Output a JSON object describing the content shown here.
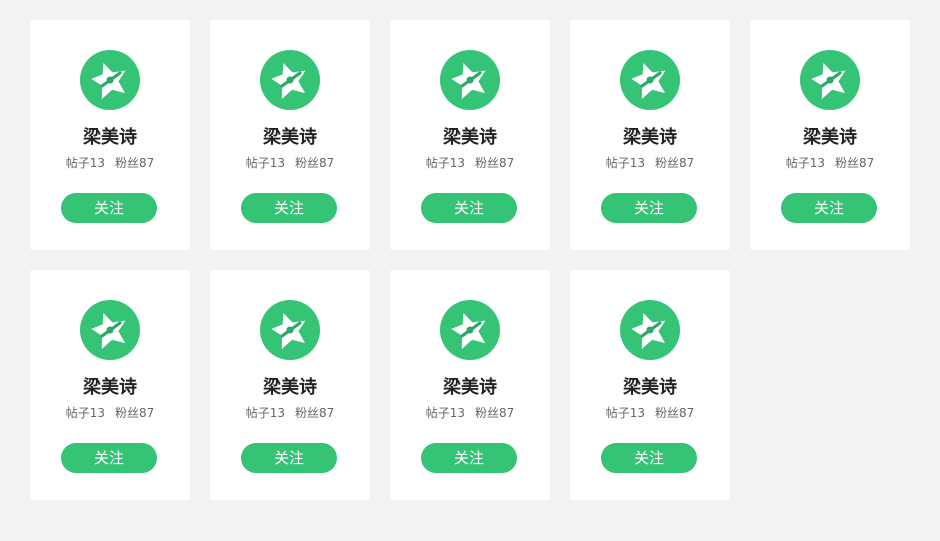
{
  "colors": {
    "accent": "#35c376",
    "card_bg": "#ffffff",
    "page_bg": "#f2f2f2"
  },
  "cards": [
    {
      "name": "梁美诗",
      "posts_label": "帖子13",
      "fans_label": "粉丝87",
      "button_label": "关注",
      "avatar_icon": "star-logo-icon"
    },
    {
      "name": "梁美诗",
      "posts_label": "帖子13",
      "fans_label": "粉丝87",
      "button_label": "关注",
      "avatar_icon": "star-logo-icon"
    },
    {
      "name": "梁美诗",
      "posts_label": "帖子13",
      "fans_label": "粉丝87",
      "button_label": "关注",
      "avatar_icon": "star-logo-icon"
    },
    {
      "name": "梁美诗",
      "posts_label": "帖子13",
      "fans_label": "粉丝87",
      "button_label": "关注",
      "avatar_icon": "star-logo-icon"
    },
    {
      "name": "梁美诗",
      "posts_label": "帖子13",
      "fans_label": "粉丝87",
      "button_label": "关注",
      "avatar_icon": "star-logo-icon"
    },
    {
      "name": "梁美诗",
      "posts_label": "帖子13",
      "fans_label": "粉丝87",
      "button_label": "关注",
      "avatar_icon": "star-logo-icon"
    },
    {
      "name": "梁美诗",
      "posts_label": "帖子13",
      "fans_label": "粉丝87",
      "button_label": "关注",
      "avatar_icon": "star-logo-icon"
    },
    {
      "name": "梁美诗",
      "posts_label": "帖子13",
      "fans_label": "粉丝87",
      "button_label": "关注",
      "avatar_icon": "star-logo-icon"
    },
    {
      "name": "梁美诗",
      "posts_label": "帖子13",
      "fans_label": "粉丝87",
      "button_label": "关注",
      "avatar_icon": "star-logo-icon"
    }
  ]
}
